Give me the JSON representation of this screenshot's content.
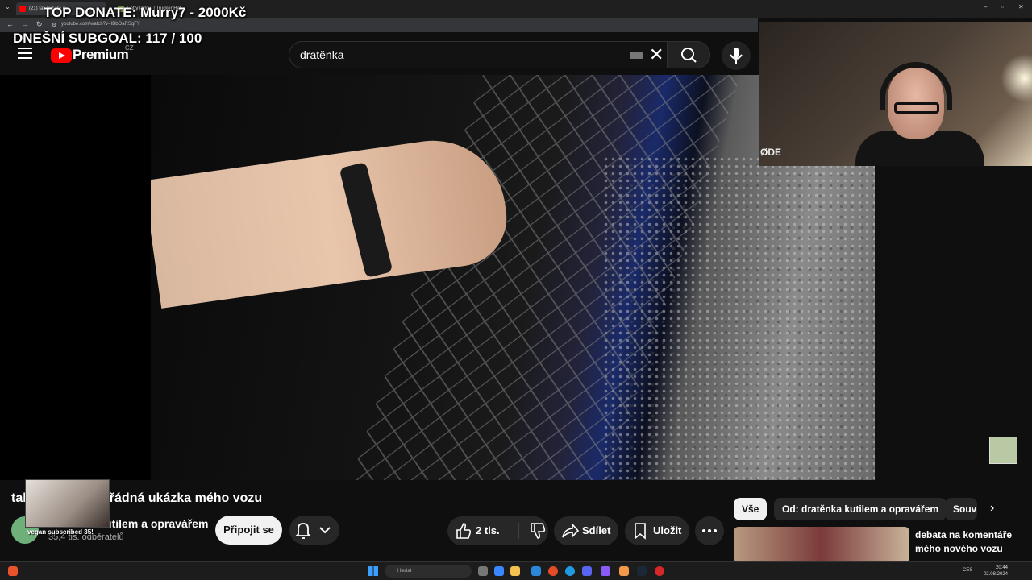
{
  "browser": {
    "tabs": [
      {
        "label": "(21) tak tady to je ",
        "favicon_color": "#ff0000"
      },
      {
        "label": "Fatty Pillow | Trucker Hat",
        "favicon_color": "#8ab34a"
      }
    ],
    "url": "youtube.com/watch?v=IBbOaRSqFY",
    "window_controls": [
      "–",
      "▫",
      "✕"
    ]
  },
  "overlay": {
    "top_donate": "TOP DONATE: Murry7 - 2000Kč",
    "subgoal": "DNEŠNÍ SUBGOAL: 117 / 100",
    "alert": "vegan subscribed 35!"
  },
  "youtube": {
    "brand": "Premium",
    "country": "CZ",
    "search_value": "dratěnka",
    "webcam_mic_label": "ØDE"
  },
  "video": {
    "title": "tak tady to je pořádná ukázka mého vozu",
    "channel_name": "dratěnka kutilem a opravářem",
    "subscribers": "35,4 tis. odběratelů",
    "join_label": "Připojit se",
    "like_count": "2 tis.",
    "share_label": "Sdílet",
    "save_label": "Uložit"
  },
  "chips": {
    "all": "Vše",
    "from": "Od: dratěnka kutilem a opravářem",
    "related": "Souv",
    "next": "›"
  },
  "recommendation": {
    "title": "debata na komentáře mého nového vozu"
  },
  "taskbar": {
    "search_placeholder": "Hledat",
    "lang": "CES",
    "time": "20:44",
    "date": "02.08.2024"
  },
  "colors": {
    "accent": "#ff0000",
    "background": "#0f0f0f",
    "button_bg": "#272727"
  }
}
